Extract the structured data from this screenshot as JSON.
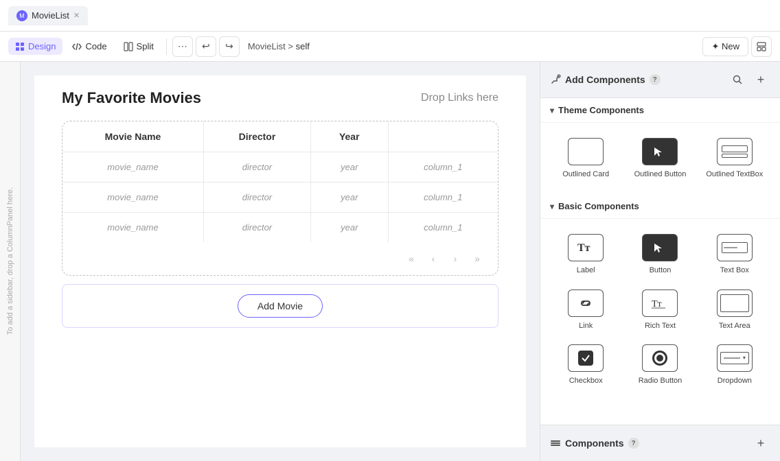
{
  "tabs": [
    {
      "id": "movielist",
      "label": "MovieList",
      "active": true
    }
  ],
  "toolbar": {
    "design_label": "Design",
    "code_label": "Code",
    "split_label": "Split",
    "breadcrumb_root": "MovieList",
    "breadcrumb_sep": ">",
    "breadcrumb_current": "self",
    "new_label": "✦ New"
  },
  "canvas": {
    "title": "My Favorite Movies",
    "drop_links": "Drop Links here",
    "table": {
      "headers": [
        "Movie Name",
        "Director",
        "Year",
        ""
      ],
      "rows": [
        [
          "movie_name",
          "director",
          "year",
          "column_1"
        ],
        [
          "movie_name",
          "director",
          "year",
          "column_1"
        ],
        [
          "movie_name",
          "director",
          "year",
          "column_1"
        ]
      ]
    },
    "add_button_label": "Add Movie",
    "left_sidebar_text": "To add a sidebar, drop a ColumnPanel here."
  },
  "right_panel": {
    "add_components_title": "Add Components",
    "help_badge": "?",
    "theme_section_label": "Theme Components",
    "basic_section_label": "Basic Components",
    "components_section_label": "Components",
    "theme_components": [
      {
        "id": "outlined-card",
        "label": "Outlined Card",
        "icon_type": "grid"
      },
      {
        "id": "outlined-button",
        "label": "Outlined Button",
        "icon_type": "cursor"
      },
      {
        "id": "outlined-textbox",
        "label": "Outlined TextBox",
        "icon_type": "textbox"
      }
    ],
    "basic_components": [
      {
        "id": "label",
        "label": "Label",
        "icon_type": "text"
      },
      {
        "id": "button",
        "label": "Button",
        "icon_type": "cursor-dark"
      },
      {
        "id": "text-box",
        "label": "Text Box",
        "icon_type": "textbox-small"
      },
      {
        "id": "link",
        "label": "Link",
        "icon_type": "link"
      },
      {
        "id": "rich-text",
        "label": "Rich Text",
        "icon_type": "richtext"
      },
      {
        "id": "text-area",
        "label": "Text Area",
        "icon_type": "textarea"
      },
      {
        "id": "checkbox",
        "label": "Checkbox",
        "icon_type": "checkbox"
      },
      {
        "id": "radio-button",
        "label": "Radio Button",
        "icon_type": "radio"
      },
      {
        "id": "dropdown",
        "label": "Dropdown",
        "icon_type": "dropdown"
      }
    ]
  }
}
